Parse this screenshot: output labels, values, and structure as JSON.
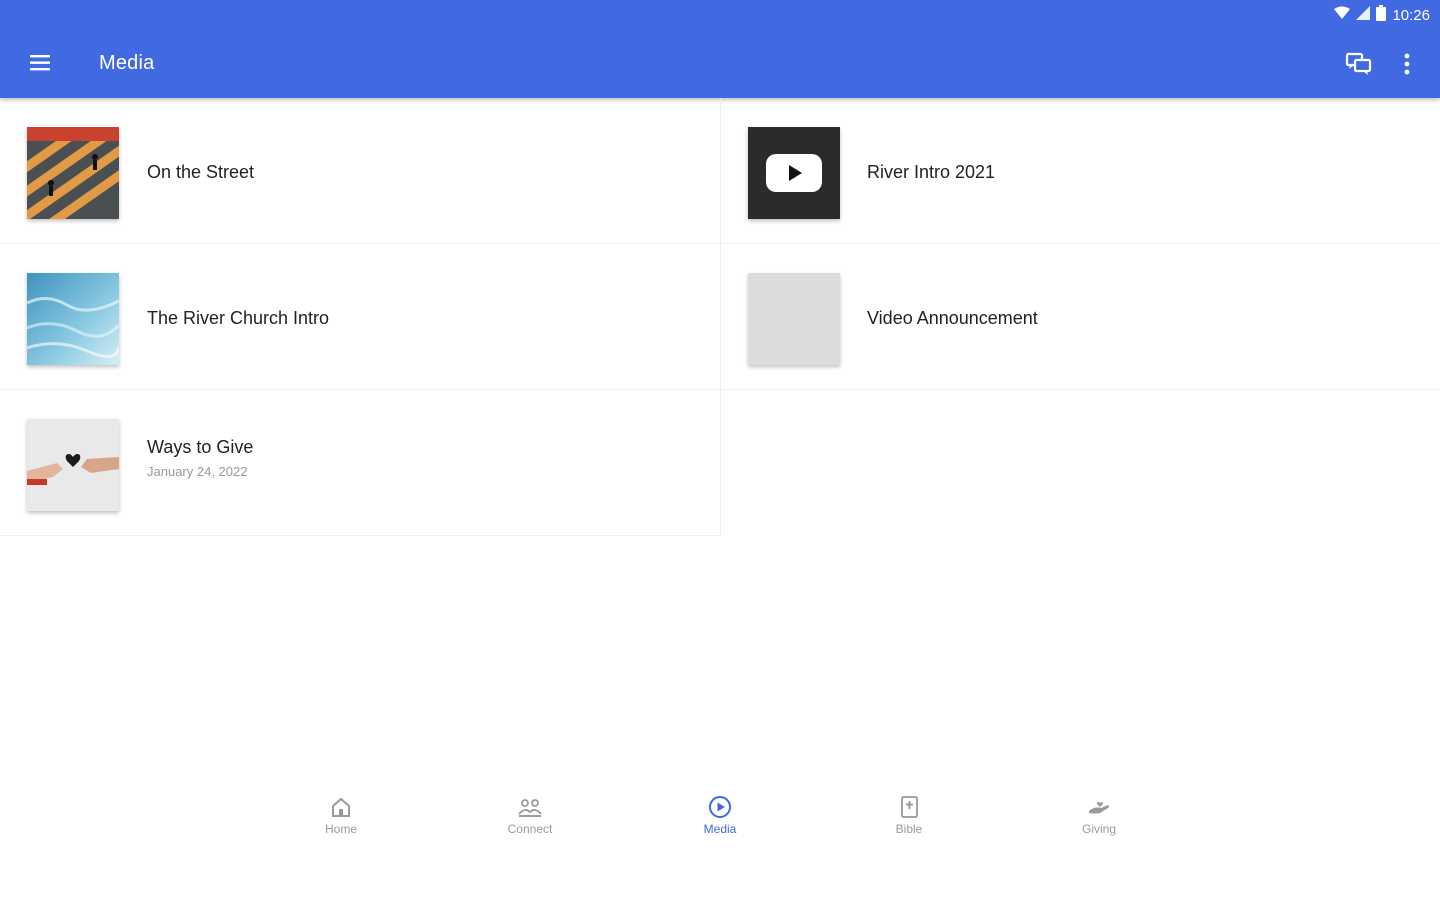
{
  "status": {
    "time": "10:26"
  },
  "appbar": {
    "title": "Media"
  },
  "colors": {
    "primary": "#4169e1",
    "inactive": "#9a9a9a"
  },
  "media": {
    "left": [
      {
        "title": "On the Street",
        "subtitle": "",
        "thumb": "street-crosswalk-photo"
      },
      {
        "title": "The River Church Intro",
        "subtitle": "",
        "thumb": "blue-water-photo"
      },
      {
        "title": "Ways to Give",
        "subtitle": "January 24, 2022",
        "thumb": "hands-heart-photo"
      }
    ],
    "right": [
      {
        "title": "River Intro 2021",
        "subtitle": "",
        "thumb": "video-play-thumbnail"
      },
      {
        "title": "Video Announcement",
        "subtitle": "",
        "thumb": "gray-blank-thumbnail"
      }
    ]
  },
  "nav": [
    {
      "label": "Home",
      "icon": "home-icon"
    },
    {
      "label": "Connect",
      "icon": "people-icon"
    },
    {
      "label": "Media",
      "icon": "play-circle-icon",
      "active": true
    },
    {
      "label": "Bible",
      "icon": "bible-icon"
    },
    {
      "label": "Giving",
      "icon": "giving-hand-icon"
    }
  ]
}
